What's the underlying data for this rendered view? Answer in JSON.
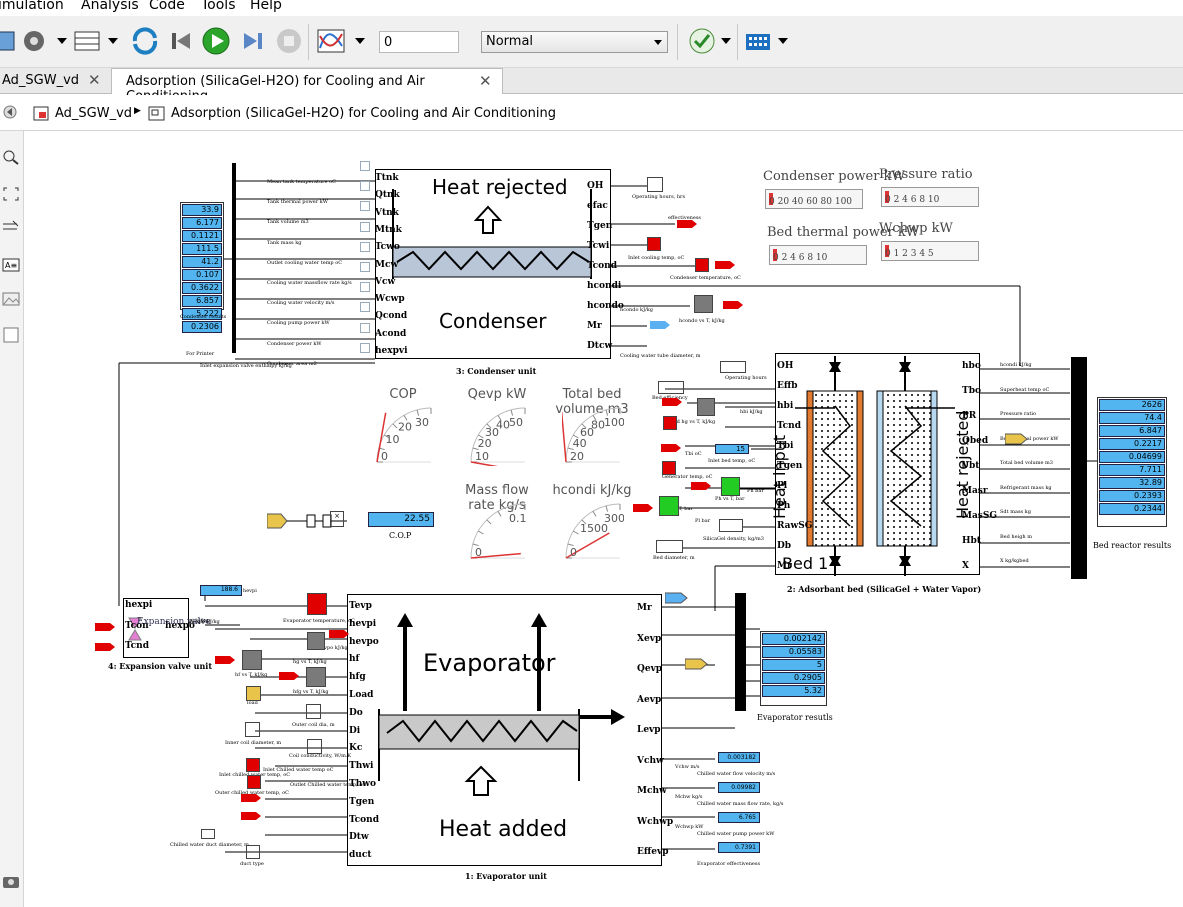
{
  "menu": [
    "imulation",
    "Analysis",
    "Code",
    "Tools",
    "Help"
  ],
  "toolbar": {
    "step_value": "0",
    "mode": "Normal"
  },
  "tabs": [
    {
      "label": "Ad_SGW_vd",
      "close": "✕"
    },
    {
      "label": "Adsorption (SilicaGel-H2O) for Cooling and Air Conditioning",
      "close": "✕"
    }
  ],
  "breadcrumb": {
    "root": "Ad_SGW_vd",
    "sep": "▶",
    "current": "Adsorption (SilicaGel-H2O) for Cooling and Air Conditioning"
  },
  "condenser": {
    "title": "Heat rejected",
    "name": "Condenser",
    "caption": "3: Condenser unit",
    "ports_left": [
      "Ttnk",
      "Qtnk",
      "Vtnk",
      "Mtnk",
      "Tcwo",
      "Mcw",
      "Vcw",
      "Wcwp",
      "Qcond",
      "Acond",
      "hexpvi"
    ],
    "ports_right": [
      "OH",
      "efac",
      "Tgen",
      "Tcwi",
      "Tcond",
      "hcondi",
      "hcondo",
      "Mr",
      "Dtcw"
    ],
    "results_label": "Condenser results",
    "results_values": [
      "33.9",
      "6.177",
      "0.1121",
      "111.5",
      "41.2",
      "0.107",
      "0.3622",
      "6.857",
      "5.222",
      "0.2306"
    ],
    "signal_names": [
      "Mean tank temperature oC",
      "Tank thermal power kW",
      "Tank volume m3",
      "Tank mass kg",
      "Outlet cooling water temp oC",
      "Cooling water massflow rate kg/s",
      "Cooling water velocity m/s",
      "Cooling pump power kW",
      "Condenser power kW",
      "Condenser area m2"
    ],
    "for_printer": "For Printer",
    "inlet_exp": "Inlet expansion valve enthalpy kJ/kg",
    "right_labels": [
      "Operating hours, hrs",
      "effectiveness",
      "Inlet cooling temp, oC",
      "Condenser temperature, oC",
      "hcondo kJ/kg",
      "hcondo vs T, kJ/kg",
      "Cooling water tube diameter, m"
    ]
  },
  "meters": [
    {
      "title": "Condenser power kW",
      "ticks": "0 20 40 60 80 100"
    },
    {
      "title": "Pressure ratio",
      "ticks": "0 2 4 6 8 10"
    },
    {
      "title": "Bed thermal power kW",
      "ticks": "0 2 4 6 8 10"
    },
    {
      "title": "Wchwp kW",
      "ticks": "0 1 2 3 4 5"
    }
  ],
  "gauges": [
    {
      "title": "COP",
      "ticks": [
        "0",
        "10",
        "20",
        "30"
      ]
    },
    {
      "title": "Qevp kW",
      "ticks": [
        "10",
        "20",
        "30",
        "40",
        "50"
      ]
    },
    {
      "title": "Total bed volume m3",
      "ticks": [
        "20",
        "40",
        "60",
        "80",
        "100"
      ]
    },
    {
      "title": "Mass flow rate kg/s",
      "ticks": [
        "0",
        "0.1"
      ]
    },
    {
      "title": "hcondi kJ/kg",
      "ticks": [
        "0",
        "1500",
        "3000"
      ]
    }
  ],
  "cop": {
    "value": "22.55",
    "label": "C.O.P"
  },
  "bed": {
    "caption": "2: Adsorbant bed (SilicaGel + Water Vapor)",
    "bed_label": "Bed 1",
    "heat_input": "Heat input",
    "heat_rejected": "Heat rejected",
    "ports_left": [
      "OH",
      "Effb",
      "hbi",
      "Tcnd",
      "Tbi",
      "Tgen",
      "Pl",
      "Ph",
      "RawSG",
      "Db",
      "Mr"
    ],
    "ports_right": [
      "hbo",
      "Tbo",
      "PR",
      "Qbed",
      "Vbt",
      "Masr",
      "MasSG",
      "Hbt",
      "X"
    ],
    "results_label": "Bed reactor results",
    "results_values": [
      "2626",
      "74.4",
      "6.847",
      "0.2217",
      "0.04699",
      "7.711",
      "32.89",
      "0.2393",
      "0.2344"
    ],
    "signal_names": [
      "hcondi kJ/kg",
      "Superheat temp oC",
      "Pressure ratio",
      "Bed thermal power kW",
      "Total bed volume m3",
      "Refrigerant mass kg",
      "Sdt mass kg",
      "Bed heigh m",
      "X kg/kgbed"
    ],
    "left_labels": [
      "Operating hours",
      "Bed efficiency",
      "hbi kJ/kg",
      "Bed hg vs T, kJ/kg",
      "Tbi oC",
      "Inlet bed temp, oC",
      "Generator temp, oC",
      "Ph vs T, bar",
      "Ph bar",
      "Pl vs T, bar",
      "Pl bar",
      "SilicaGel density, kg/m3",
      "Bed diameter, m"
    ],
    "tbi_value": "15"
  },
  "evaporator": {
    "name": "Evaporator",
    "heat_added": "Heat added",
    "caption": "1: Evaporator unit",
    "ports_left": [
      "Tevp",
      "hevpi",
      "hevpo",
      "hf",
      "hfg",
      "Load",
      "Do",
      "Di",
      "Kc",
      "Thwi",
      "Thwo",
      "Tgen",
      "Tcond",
      "Dtw",
      "duct"
    ],
    "ports_right": [
      "Mr",
      "Xevp",
      "Qevp",
      "Aevp",
      "Levp",
      "Vchw",
      "Mchw",
      "Wchwp",
      "Effevp"
    ],
    "results_label": "Evaporator resutls",
    "results_values": [
      "0.002142",
      "0.05583",
      "5",
      "0.2905",
      "5.32"
    ],
    "small_outputs": [
      {
        "name": "Vchw m/s",
        "value": "0.003182",
        "label": "Chilled water flow velocity m/s"
      },
      {
        "name": "Mchw kg/s",
        "value": "0.09982",
        "label": "Chilled water mass flow rate, kg/s"
      },
      {
        "name": "Wchwp kW",
        "value": "6.765",
        "label": "Chilled water pump power kW"
      },
      {
        "name": "",
        "value": "0.7391",
        "label": "Evaporator effectiveness"
      }
    ],
    "left_labels": [
      "Evaporator temperature, oC",
      "hevpo kJ/kg",
      "hg vs T, kJ/kg",
      "hf vs T, kJ/kg",
      "hfg vs T, kJ/kg",
      "load",
      "Outer coil dia, m",
      "Inner coil diameter, m",
      "Coil conductivity, W/m.K",
      "Inlet chilled water temp, oC",
      "Outlet Chilled water temp, oC",
      "Outer chilled water temp, oC",
      "Chilled water duct diameter, m",
      "duct type",
      "Inlet Chilled water temp oC",
      "hevpi kJ/kg"
    ],
    "hevpi_value": "188.6",
    "hevpi_label": "hevpi"
  },
  "expansion": {
    "caption": "4: Expansion valve unit",
    "ports": [
      "hexpi",
      "Tcon",
      "Tcnd",
      "hexpo"
    ],
    "inner": "Expansion valve",
    "hexpo_label": "hexpo kJ/kg"
  },
  "colors": {
    "signal_blue": "#53b5f0",
    "signal_red": "#e00000",
    "block_gray": "#7a7a7a",
    "bed_orange": "#e27a2f",
    "coil_fill": "#b8c6d8"
  }
}
